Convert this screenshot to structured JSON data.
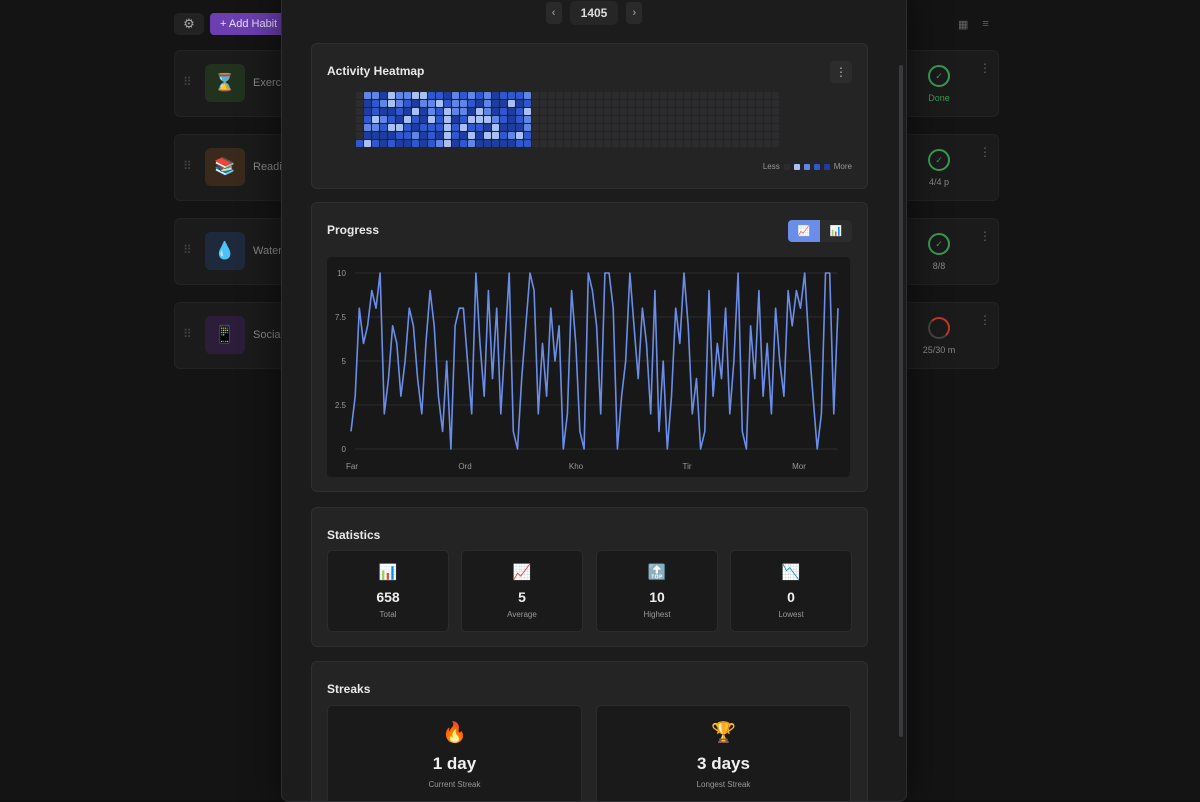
{
  "toolbar": {
    "add_label": "+ Add Habit",
    "settings_icon": "gear-icon"
  },
  "view_icons": {
    "grid": "▦",
    "list": "≡"
  },
  "habits": [
    {
      "name": "Exercis",
      "icon": "⌛",
      "status": "Done",
      "status_color": "#3a9a52",
      "icon_bg": "#21331f"
    },
    {
      "name": "Readi",
      "icon": "📚",
      "status": "4/4 p",
      "status_color": "#3a9a52",
      "icon_bg": "#3a2a1c"
    },
    {
      "name": "Water",
      "icon": "💧",
      "status": "8/8",
      "status_color": "#3a9a52",
      "icon_bg": "#1e2a3c"
    },
    {
      "name": "Social",
      "icon": "📱",
      "status": "25/30 m",
      "status_color": "#c0392b",
      "icon_bg": "#2c1e3a"
    }
  ],
  "modal": {
    "year": "1405",
    "prev_label": "‹",
    "next_label": "›",
    "heatmap": {
      "title": "Activity Heatmap",
      "legend_less": "Less",
      "legend_more": "More",
      "colors": [
        "#2c2c2e",
        "#1e3da0",
        "#2f58cf",
        "#5f86e6",
        "#a9c1f2"
      ],
      "active_weeks": 22
    },
    "progress": {
      "title": "Progress",
      "line_icon": "📈",
      "bar_icon": "📊"
    },
    "statistics": {
      "title": "Statistics",
      "cards": [
        {
          "icon": "📊",
          "value": "658",
          "label": "Total"
        },
        {
          "icon": "📈",
          "value": "5",
          "label": "Average"
        },
        {
          "icon": "🔝",
          "value": "10",
          "label": "Highest"
        },
        {
          "icon": "📉",
          "value": "0",
          "label": "Lowest"
        }
      ]
    },
    "streaks": {
      "title": "Streaks",
      "cards": [
        {
          "icon": "🔥",
          "value": "1 day",
          "label": "Current Streak"
        },
        {
          "icon": "🏆",
          "value": "3 days",
          "label": "Longest Streak"
        }
      ]
    }
  },
  "chart_data": {
    "type": "line",
    "ylim": [
      0,
      10
    ],
    "yticks": [
      "0",
      "2.5",
      "5",
      "7.5",
      "10"
    ],
    "xticks": [
      "Far",
      "Ord",
      "Kho",
      "Tir",
      "Mor"
    ],
    "color": "#6a8ee8",
    "values": [
      1,
      3,
      8,
      6,
      7,
      9,
      8,
      10,
      2,
      4,
      7,
      6,
      3,
      5,
      8,
      7,
      4,
      2,
      6,
      9,
      7,
      3,
      1,
      5,
      0,
      7,
      8,
      8,
      5,
      2,
      10,
      6,
      3,
      9,
      4,
      8,
      2,
      6,
      10,
      1,
      0,
      4,
      7,
      10,
      9,
      2,
      6,
      3,
      8,
      5,
      7,
      0,
      2,
      9,
      6,
      1,
      0,
      10,
      9,
      7,
      2,
      10,
      10,
      8,
      0,
      3,
      5,
      10,
      7,
      4,
      8,
      6,
      2,
      9,
      1,
      5,
      0,
      3,
      8,
      6,
      10,
      7,
      2,
      4,
      0,
      1,
      9,
      3,
      6,
      4,
      8,
      2,
      5,
      10,
      1,
      0,
      7,
      4,
      9,
      3,
      6,
      2,
      8,
      5,
      3,
      9,
      7,
      9,
      8,
      10,
      6,
      3,
      0,
      2,
      10,
      10,
      2,
      8
    ]
  }
}
